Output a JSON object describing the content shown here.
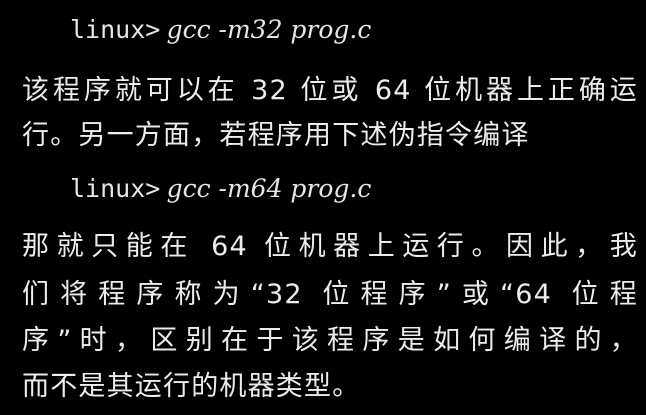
{
  "colors": {
    "background": "#000000",
    "text": "#ececec"
  },
  "commands": [
    {
      "prompt": "linux>",
      "code": "gcc -m32 prog.c"
    },
    {
      "prompt": "linux>",
      "code": "gcc -m64 prog.c"
    }
  ],
  "paragraphs": {
    "first": [
      "该程序就可以在 32 位或 64 位机器上正确运",
      "行。另一方面，若程序用下述伪指令编译"
    ],
    "second": [
      "那就只能在 64 位机器上运行。因此，我",
      "们将程序称为“32 位程序”或“64 位程",
      "序”时，区别在于该程序是如何编译的，",
      "而不是其运行的机器类型。"
    ]
  }
}
